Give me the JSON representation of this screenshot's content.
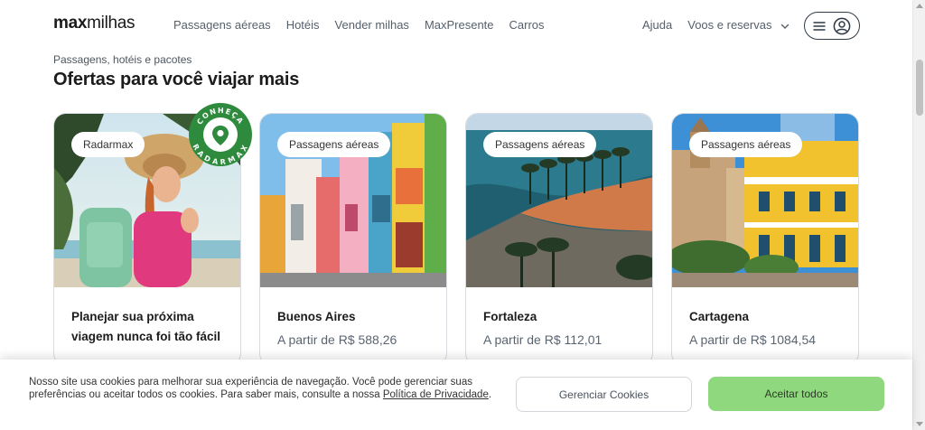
{
  "header": {
    "logo_bold": "max",
    "logo_regular": "milhas",
    "nav": [
      "Passagens aéreas",
      "Hotéis",
      "Vender milhas",
      "MaxPresente",
      "Carros"
    ],
    "help": "Ajuda",
    "trips": "Voos e reservas",
    "icons": {
      "menu": "hamburger-icon",
      "account": "user-icon"
    }
  },
  "section": {
    "eyebrow": "Passagens, hotéis e pacotes",
    "title": "Ofertas para você viajar mais"
  },
  "cards": [
    {
      "tag": "Radarmax",
      "title": "Planejar sua próxima viagem nunca foi tão fácil",
      "price": "",
      "badge": {
        "top": "CONHEÇA",
        "bottom": "RADARMAX"
      }
    },
    {
      "tag": "Passagens aéreas",
      "title": "Buenos Aires",
      "price": "A partir de R$ 588,26"
    },
    {
      "tag": "Passagens aéreas",
      "title": "Fortaleza",
      "price": "A partir de R$ 112,01"
    },
    {
      "tag": "Passagens aéreas",
      "title": "Cartagena",
      "price": "A partir de R$ 1084,54"
    }
  ],
  "cookie": {
    "text": "Nosso site usa cookies para melhorar sua experiência de navegação. Você pode gerenciar suas preferências ou aceitar todos os cookies. Para saber mais, consulte a nossa ",
    "link": "Política de Privacidade",
    "after": ".",
    "manage": "Gerenciar Cookies",
    "accept": "Aceitar todos"
  },
  "colors": {
    "accent_green": "#8fd87e",
    "badge_green": "#2e8b3e",
    "text_dark": "#1c1c1c",
    "text_muted": "#56606b"
  }
}
